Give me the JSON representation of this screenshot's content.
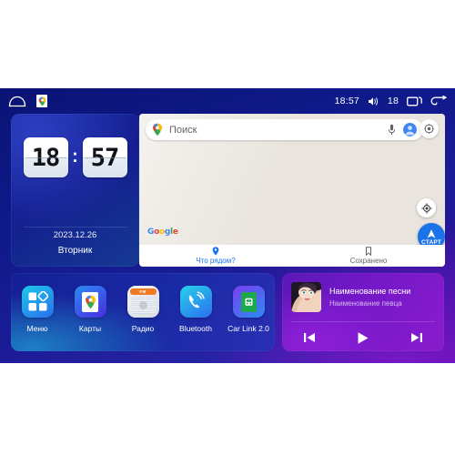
{
  "statusbar": {
    "home_icon": "home-icon",
    "maps_notification_icon": "google-maps-notification-icon",
    "time": "18:57",
    "volume_icon": "volume-icon",
    "volume_level": "18",
    "recents_icon": "recents-icon",
    "back_icon": "back-icon"
  },
  "clock_widget": {
    "hours": "18",
    "separator": ":",
    "minutes": "57",
    "date": "2023.12.26",
    "weekday": "Вторник"
  },
  "maps_widget": {
    "search": {
      "placeholder": "Поиск",
      "value": "",
      "pin_icon": "google-maps-pin-icon",
      "mic_icon": "microphone-icon",
      "avatar_icon": "account-avatar-icon"
    },
    "layers_icon": "map-layers-icon",
    "locate_icon": "my-location-icon",
    "start_button": {
      "label": "СТАРТ",
      "icon": "navigation-arrow-icon"
    },
    "attribution": "Google",
    "tabs": [
      {
        "label": "Что рядом?",
        "icon": "location-pin-icon",
        "active": true
      },
      {
        "label": "Сохранено",
        "icon": "bookmark-icon",
        "active": false
      }
    ]
  },
  "apps_widget": {
    "items": [
      {
        "label": "Меню",
        "icon": "apps-grid-icon"
      },
      {
        "label": "Карты",
        "icon": "google-maps-icon"
      },
      {
        "label": "Радио",
        "icon": "radio-icon",
        "badge": "FM"
      },
      {
        "label": "Bluetooth",
        "icon": "bluetooth-phone-icon"
      },
      {
        "label": "Car Link 2.0",
        "icon": "car-link-icon"
      }
    ]
  },
  "music_widget": {
    "album_art_icon": "album-art-portrait",
    "title": "Наименование песни",
    "artist": "Наименование певца",
    "controls": [
      {
        "name": "previous",
        "icon": "skip-previous-icon"
      },
      {
        "name": "play",
        "icon": "play-icon"
      },
      {
        "name": "next",
        "icon": "skip-next-icon"
      }
    ]
  },
  "colors": {
    "accent_blue": "#1a73e8",
    "screen_blue": "#0e1a8a",
    "screen_purple": "#5a0fae",
    "map_bg": "#e9e5de",
    "music_purple": "#7418c8"
  }
}
